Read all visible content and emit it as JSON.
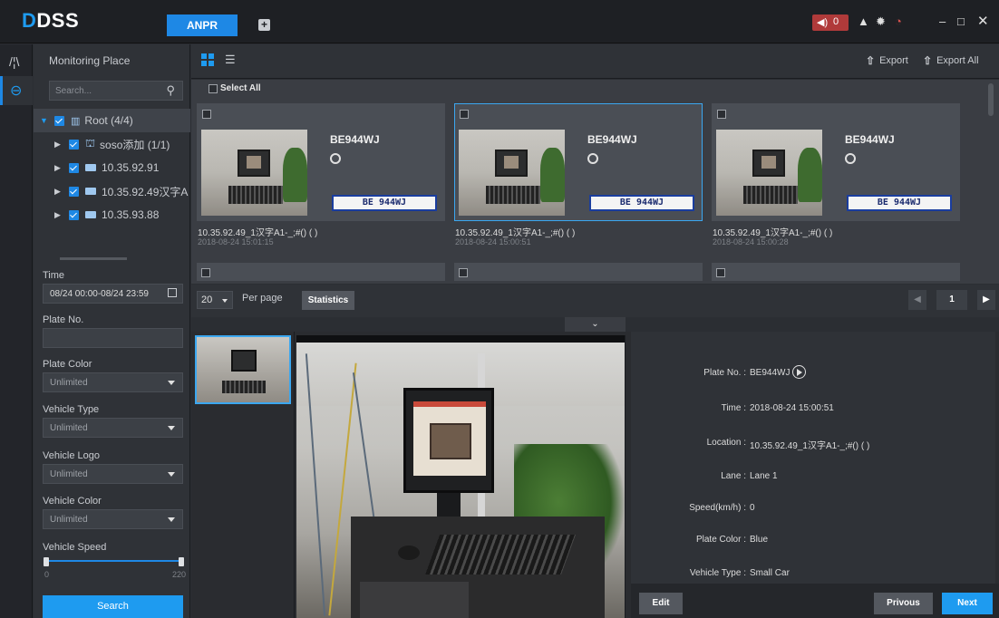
{
  "app": {
    "logo": "DSS",
    "tab_active": "ANPR",
    "add_tab": "+"
  },
  "titlebar": {
    "alarm_count": "0",
    "icons": [
      "speaker-icon",
      "user-icon",
      "gear-icon",
      "gauge-icon",
      "minimize-icon",
      "maximize-icon",
      "close-icon"
    ],
    "accent": "#1e88e5",
    "alarm_color": "#b03a3a"
  },
  "sidebar": {
    "title": "Monitoring Place",
    "search_placeholder": "Search...",
    "tree": [
      {
        "label": "Root (4/4)",
        "level": 0,
        "expanded": true,
        "icon": "network-icon"
      },
      {
        "label": "soso添加 (1/1)",
        "level": 1,
        "icon": "org-icon"
      },
      {
        "label": "10.35.92.91",
        "level": 1,
        "icon": "device-icon"
      },
      {
        "label": "10.35.92.49汉字A",
        "level": 1,
        "icon": "device-icon"
      },
      {
        "label": "10.35.93.88",
        "level": 1,
        "icon": "device-icon"
      }
    ]
  },
  "filters": {
    "time_label": "Time",
    "time_value": "08/24 00:00-08/24 23:59",
    "plate_no_label": "Plate No.",
    "plate_color_label": "Plate Color",
    "plate_color_value": "Unlimited",
    "vehicle_type_label": "Vehicle Type",
    "vehicle_type_value": "Unlimited",
    "vehicle_logo_label": "Vehicle Logo",
    "vehicle_logo_value": "Unlimited",
    "vehicle_color_label": "Vehicle Color",
    "vehicle_color_value": "Unlimited",
    "vehicle_speed_label": "Vehicle Speed",
    "speed_min": "0",
    "speed_max": "220",
    "search_button": "Search"
  },
  "toolbar": {
    "export": "Export",
    "export_all": "Export All",
    "select_all": "Select All"
  },
  "records": [
    {
      "plate": "BE944WJ",
      "plate_img": "BE 944WJ",
      "location": "10.35.92.49_1汉字A1-_;#() ( )",
      "time": "2018-08-24 15:01:15",
      "selected": false
    },
    {
      "plate": "BE944WJ",
      "plate_img": "BE 944WJ",
      "location": "10.35.92.49_1汉字A1-_;#() ( )",
      "time": "2018-08-24 15:00:51",
      "selected": true
    },
    {
      "plate": "BE944WJ",
      "plate_img": "BE 944WJ",
      "location": "10.35.92.49_1汉字A1-_;#() ( )",
      "time": "2018-08-24 15:00:28",
      "selected": false
    }
  ],
  "pager": {
    "per_page": "20",
    "per_page_label": "Per page",
    "statistics": "Statistics",
    "page": "1"
  },
  "detail": {
    "image_caption": "",
    "fields": [
      {
        "key": "Plate No. :",
        "value": "BE944WJ"
      },
      {
        "key": "Time :",
        "value": "2018-08-24 15:00:51"
      },
      {
        "key": "Location :",
        "value": "10.35.92.49_1汉字A1-_;#() ( )"
      },
      {
        "key": "Lane :",
        "value": "Lane 1"
      },
      {
        "key": "Speed(km/h) :",
        "value": "0"
      },
      {
        "key": "Plate Color :",
        "value": "Blue"
      },
      {
        "key": "Vehicle Type :",
        "value": "Small Car"
      }
    ],
    "edit": "Edit",
    "previous": "Privous",
    "next": "Next"
  }
}
